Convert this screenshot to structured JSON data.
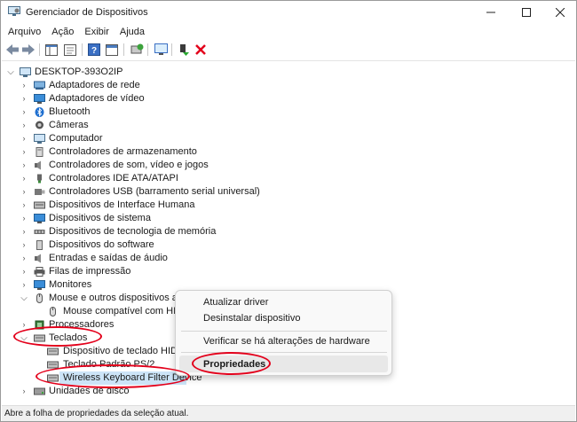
{
  "window": {
    "title": "Gerenciador de Dispositivos"
  },
  "menu": [
    "Arquivo",
    "Ação",
    "Exibir",
    "Ajuda"
  ],
  "tree": {
    "root": "DESKTOP-393O2IP",
    "items": [
      {
        "label": "Adaptadores de rede",
        "icon": "network-adapter-icon"
      },
      {
        "label": "Adaptadores de vídeo",
        "icon": "display-adapter-icon"
      },
      {
        "label": "Bluetooth",
        "icon": "bluetooth-icon"
      },
      {
        "label": "Câmeras",
        "icon": "camera-icon"
      },
      {
        "label": "Computador",
        "icon": "computer-icon"
      },
      {
        "label": "Controladores de armazenamento",
        "icon": "storage-controller-icon"
      },
      {
        "label": "Controladores de som, vídeo e jogos",
        "icon": "sound-controller-icon"
      },
      {
        "label": "Controladores IDE ATA/ATAPI",
        "icon": "ide-controller-icon"
      },
      {
        "label": "Controladores USB (barramento serial universal)",
        "icon": "usb-controller-icon"
      },
      {
        "label": "Dispositivos de Interface Humana",
        "icon": "hid-icon"
      },
      {
        "label": "Dispositivos de sistema",
        "icon": "system-device-icon"
      },
      {
        "label": "Dispositivos de tecnologia de memória",
        "icon": "memory-device-icon"
      },
      {
        "label": "Dispositivos do software",
        "icon": "software-device-icon"
      },
      {
        "label": "Entradas e saídas de áudio",
        "icon": "audio-io-icon"
      },
      {
        "label": "Filas de impressão",
        "icon": "printer-icon"
      },
      {
        "label": "Monitores",
        "icon": "monitor-icon"
      },
      {
        "label": "Mouse e outros dispositivos apo",
        "icon": "mouse-icon"
      },
      {
        "label": "Mouse compatível com HID",
        "icon": "mouse-icon"
      },
      {
        "label": "Processadores",
        "icon": "processor-icon"
      },
      {
        "label": "Teclados",
        "icon": "keyboard-icon"
      },
      {
        "label": "Dispositivo de teclado HID",
        "icon": "keyboard-icon"
      },
      {
        "label": "Teclado Padrão PS/2",
        "icon": "keyboard-icon"
      },
      {
        "label": "Wireless Keyboard Filter Device",
        "icon": "keyboard-icon"
      },
      {
        "label": "Unidades de disco",
        "icon": "disk-drive-icon"
      }
    ]
  },
  "context_menu": {
    "items": [
      "Atualizar driver",
      "Desinstalar dispositivo",
      "Verificar se há alterações de hardware",
      "Propriedades"
    ]
  },
  "status": "Abre a folha de propriedades da seleção atual.",
  "colors": {
    "annotation": "#e3001b",
    "selection": "#cce4f7"
  }
}
